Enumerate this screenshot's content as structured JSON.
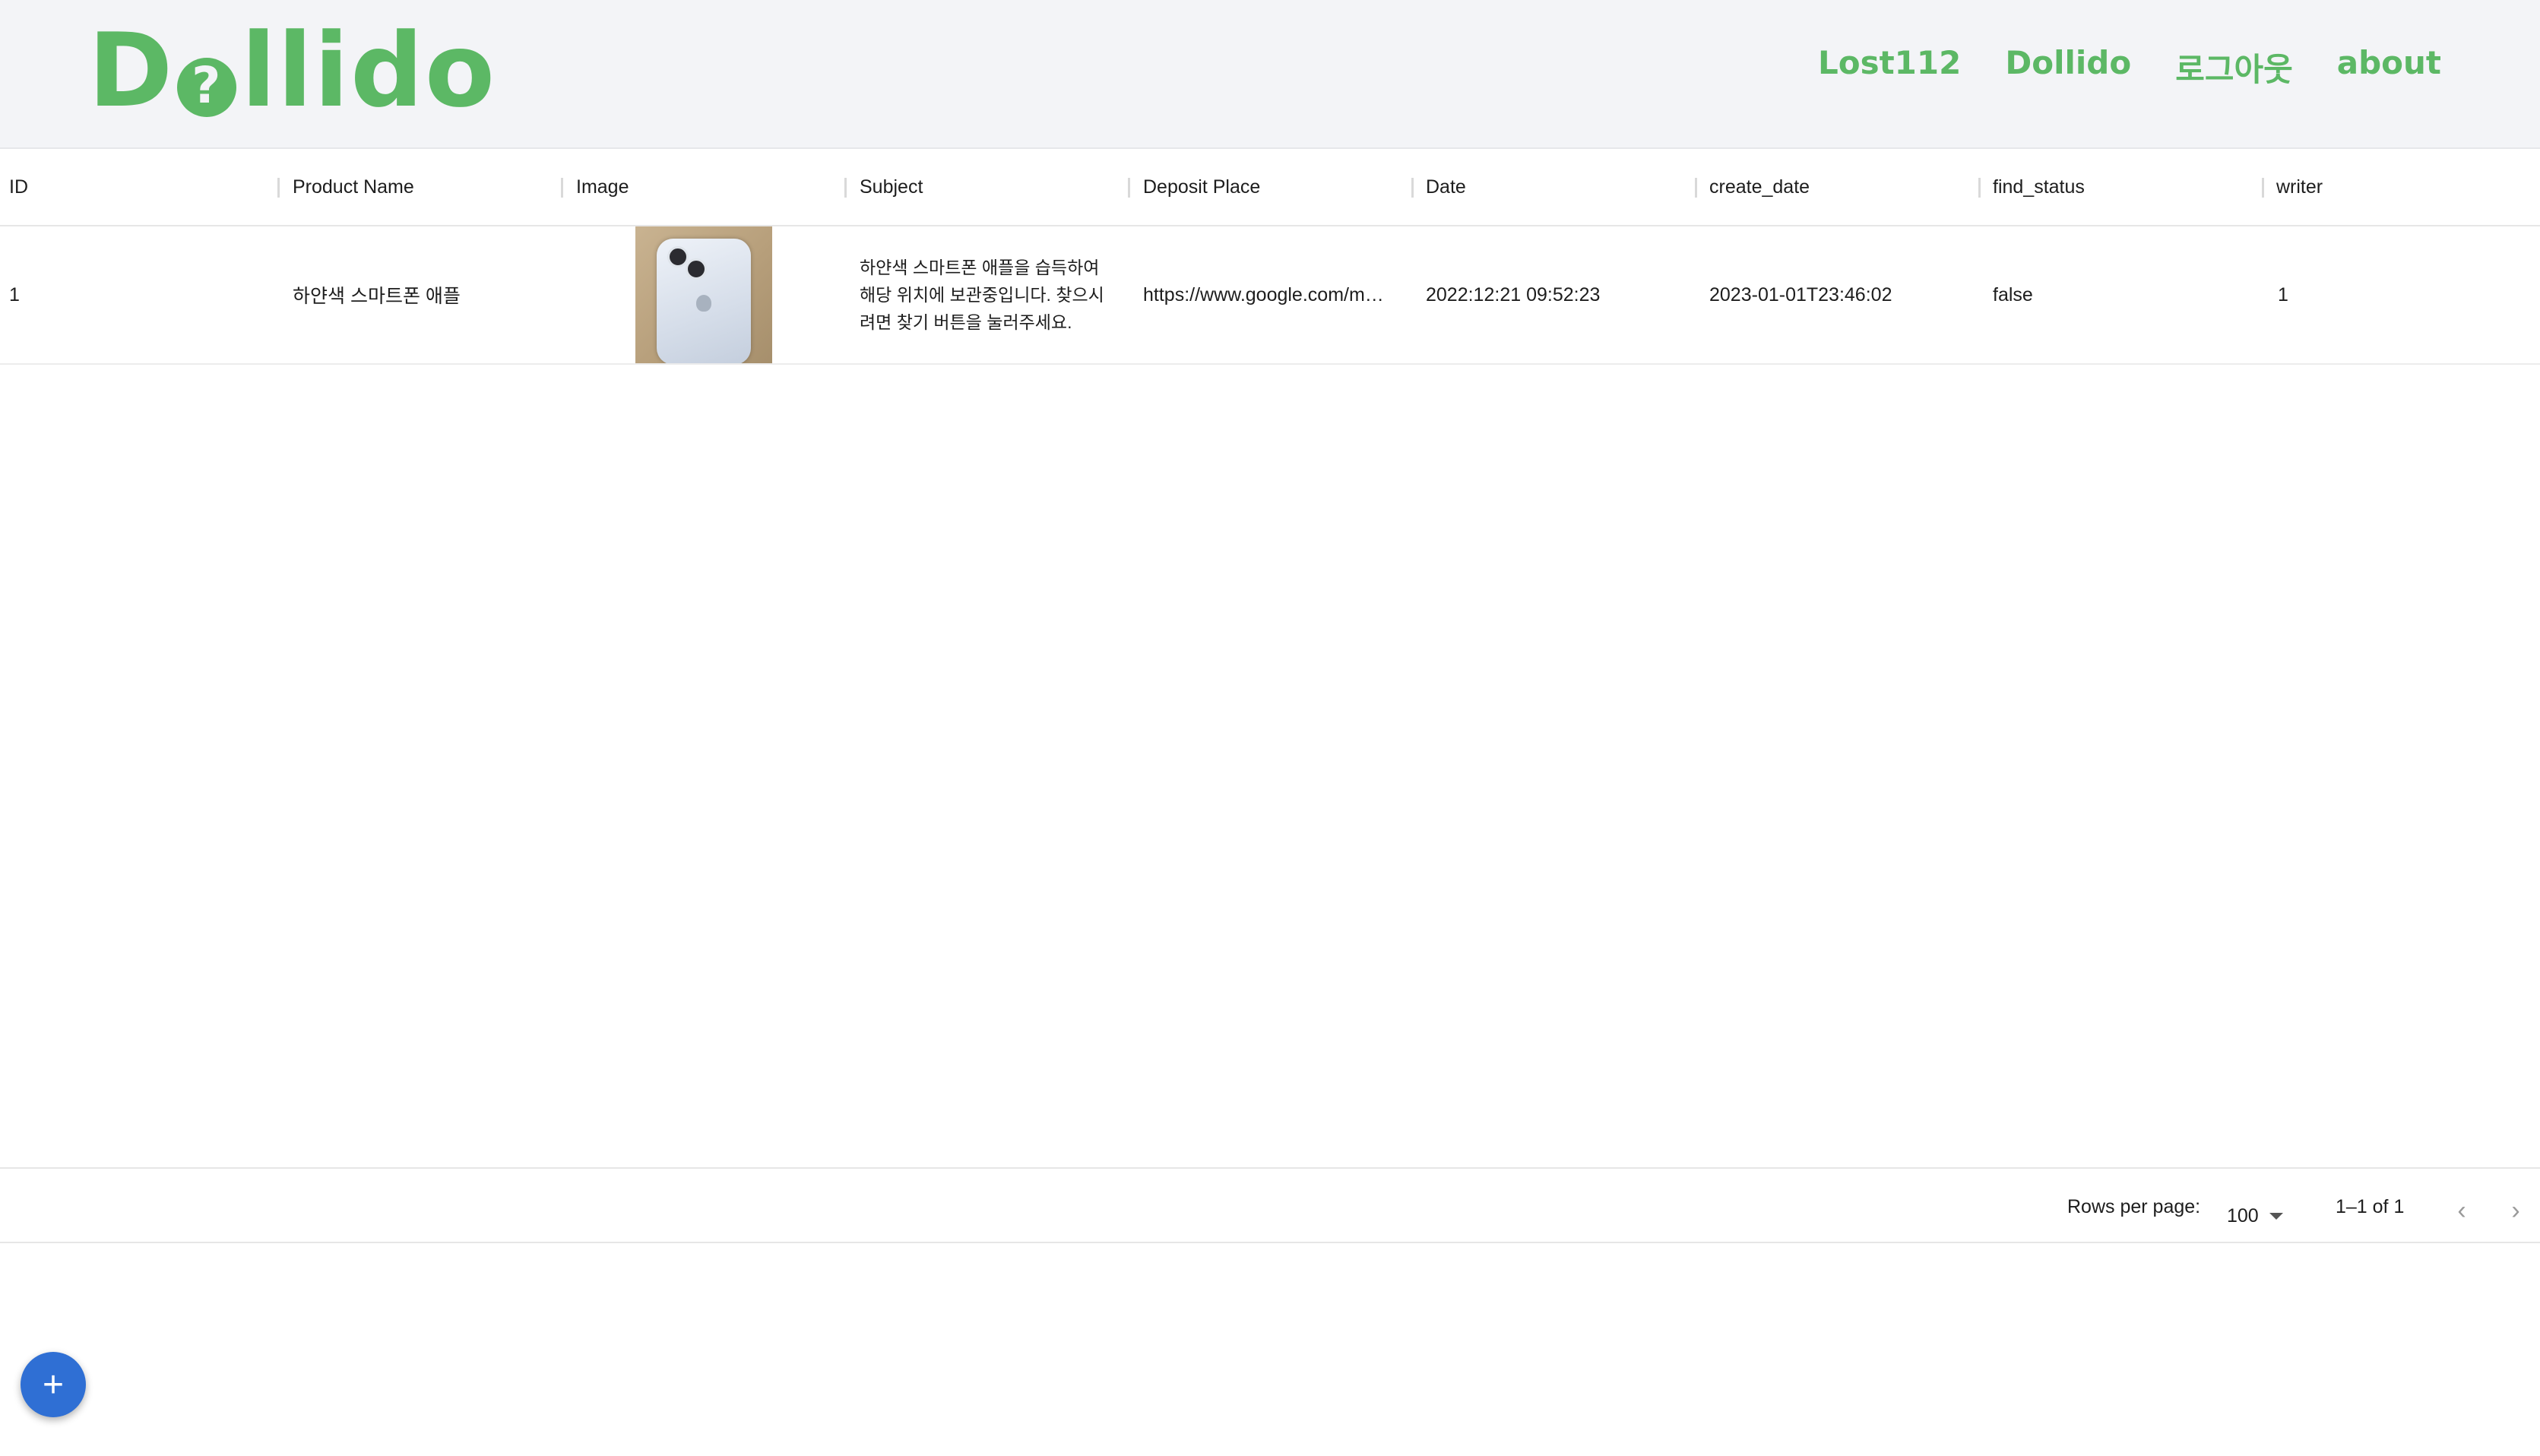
{
  "header": {
    "logo_text_prefix": "D",
    "logo_text_suffix": "llido",
    "nav": [
      "Lost112",
      "Dollido",
      "로그아웃",
      "about"
    ]
  },
  "grid": {
    "columns": [
      "ID",
      "Product Name",
      "Image",
      "Subject",
      "Deposit Place",
      "Date",
      "create_date",
      "find_status",
      "writer"
    ],
    "rows": [
      {
        "id": "1",
        "product_name": "하얀색 스마트폰 애플",
        "image_alt": "white smartphone photo",
        "subject": "하얀색 스마트폰 애플을 습득하여 해당 위치에 보관중입니다. 찾으시려면 찾기 버튼을 눌러주세요.",
        "deposit_place": "https://www.google.com/m…",
        "date": "2022:12:21 09:52:23",
        "create_date": "2023-01-01T23:46:02",
        "find_status": "false",
        "writer": "1"
      }
    ]
  },
  "footer": {
    "rows_per_page_label": "Rows per page:",
    "rows_per_page_value": "100",
    "range": "1–1 of 1",
    "prev_icon": "‹",
    "next_icon": "›"
  },
  "fab": {
    "icon": "+"
  },
  "colors": {
    "brand_green": "#5cb865",
    "header_bg": "#f3f4f7",
    "fab_blue": "#2f6fd4"
  }
}
